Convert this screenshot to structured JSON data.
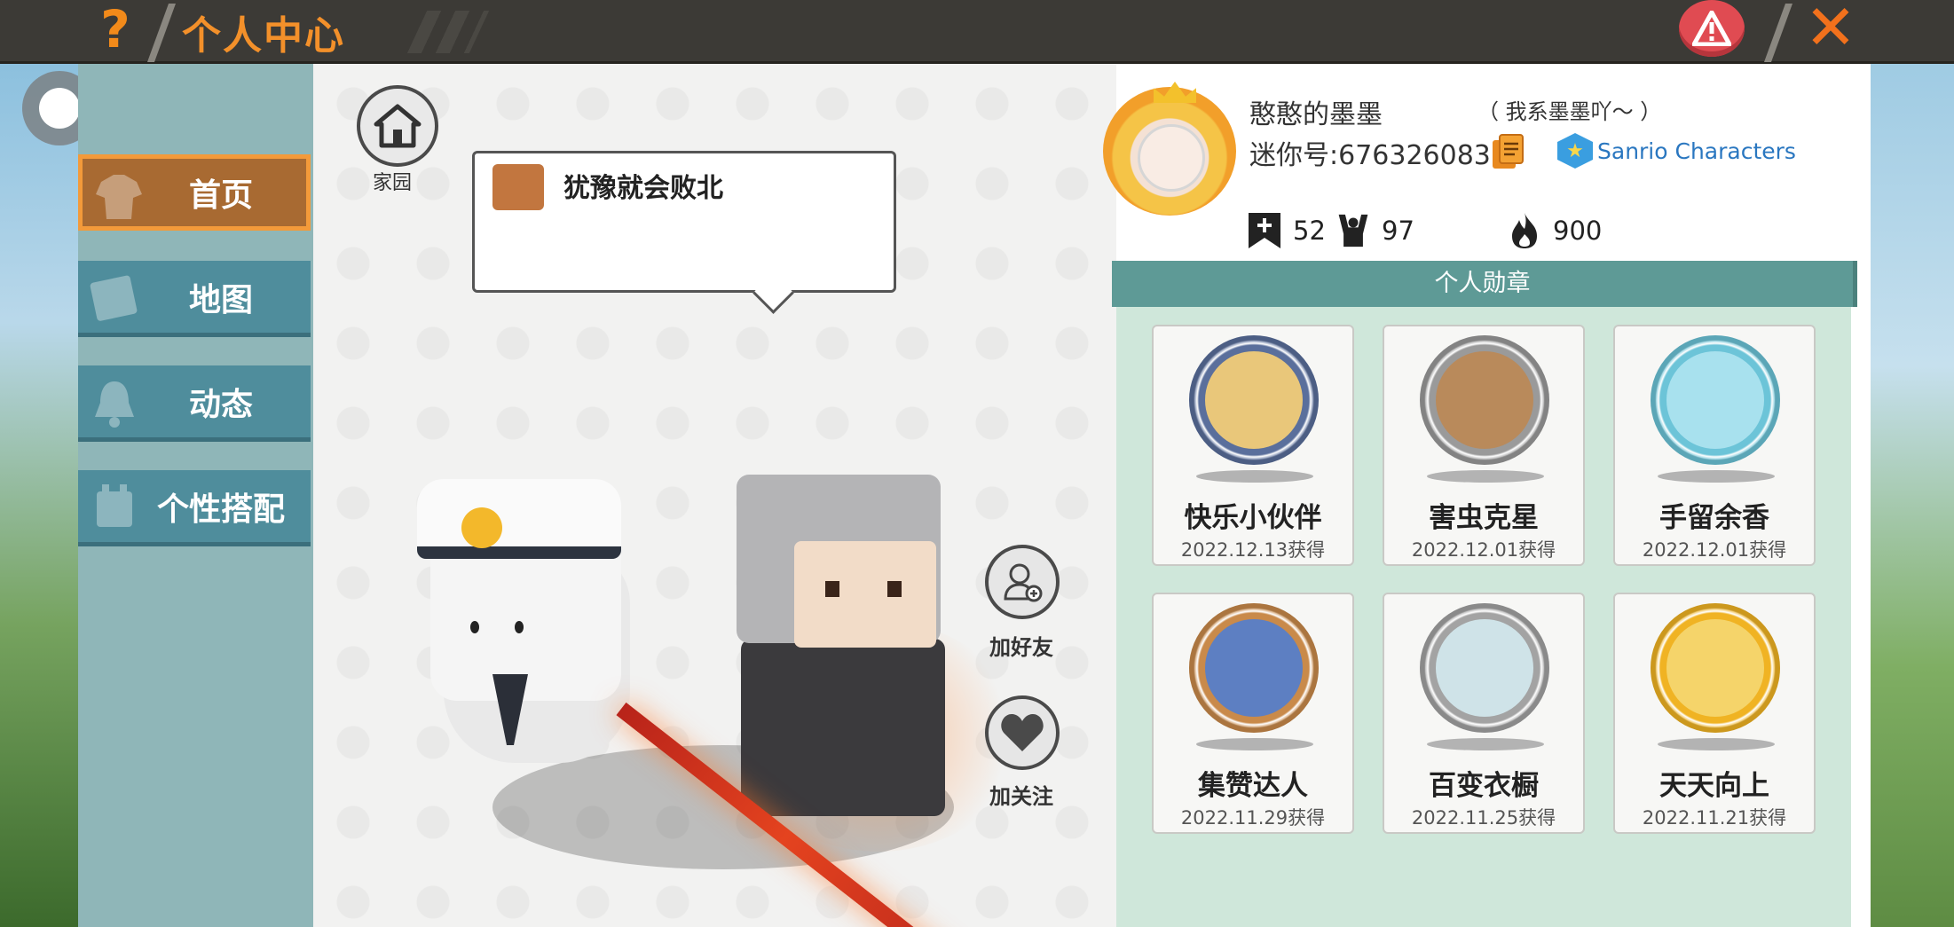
{
  "header": {
    "title": "个人中心",
    "help_icon": "question-mark",
    "warn_icon": "warning-triangle",
    "close_icon": "x-close"
  },
  "nav": {
    "items": [
      {
        "label": "首页",
        "icon": "shirt-icon",
        "active": true
      },
      {
        "label": "地图",
        "icon": "map-icon",
        "active": false
      },
      {
        "label": "动态",
        "icon": "bell-icon",
        "active": false
      },
      {
        "label": "个性搭配",
        "icon": "character-icon",
        "active": false
      }
    ]
  },
  "home": {
    "label": "家园"
  },
  "bubble": {
    "text": "犹豫就会败北"
  },
  "actions": {
    "add_friend": "加好友",
    "follow": "加关注"
  },
  "profile": {
    "nickname": "憨憨的墨墨",
    "signature": "（ 我系墨墨吖～ ）",
    "mini_id": "迷你号:676326083",
    "tag": "Sanrio Characters",
    "stats": [
      {
        "icon": "bookmark-plus-icon",
        "value": "52"
      },
      {
        "icon": "fans-icon",
        "value": "97"
      },
      {
        "icon": "fire-icon",
        "value": "900"
      }
    ]
  },
  "medals": {
    "title": "个人勋章",
    "items": [
      {
        "name": "快乐小伙伴",
        "date": "2022.12.13获得",
        "ring": "#5a6f9c",
        "inner": "#e9c77a"
      },
      {
        "name": "害虫克星",
        "date": "2022.12.01获得",
        "ring": "#9a9a9a",
        "inner": "#b98a5b"
      },
      {
        "name": "手留余香",
        "date": "2022.12.01获得",
        "ring": "#6cc4d8",
        "inner": "#a8e1ee"
      },
      {
        "name": "集赞达人",
        "date": "2022.11.29获得",
        "ring": "#c98a4a",
        "inner": "#5d7fc2"
      },
      {
        "name": "百变衣橱",
        "date": "2022.11.25获得",
        "ring": "#a3a3a3",
        "inner": "#cfe3e8"
      },
      {
        "name": "天天向上",
        "date": "2022.11.21获得",
        "ring": "#f0b323",
        "inner": "#f5d46a"
      }
    ]
  }
}
